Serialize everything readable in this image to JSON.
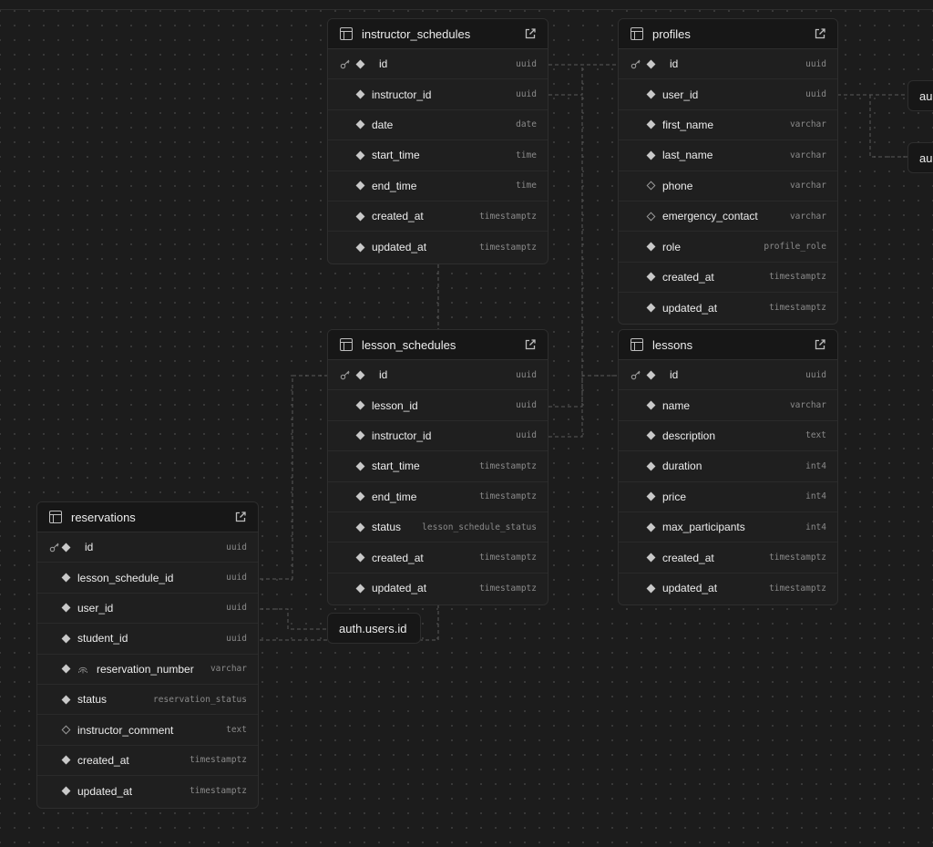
{
  "tables": {
    "instructor_schedules": {
      "name": "instructor_schedules",
      "columns": [
        {
          "name": "id",
          "type": "uuid"
        },
        {
          "name": "instructor_id",
          "type": "uuid"
        },
        {
          "name": "date",
          "type": "date"
        },
        {
          "name": "start_time",
          "type": "time"
        },
        {
          "name": "end_time",
          "type": "time"
        },
        {
          "name": "created_at",
          "type": "timestamptz"
        },
        {
          "name": "updated_at",
          "type": "timestamptz"
        }
      ]
    },
    "profiles": {
      "name": "profiles",
      "columns": [
        {
          "name": "id",
          "type": "uuid"
        },
        {
          "name": "user_id",
          "type": "uuid"
        },
        {
          "name": "first_name",
          "type": "varchar"
        },
        {
          "name": "last_name",
          "type": "varchar"
        },
        {
          "name": "phone",
          "type": "varchar"
        },
        {
          "name": "emergency_contact",
          "type": "varchar"
        },
        {
          "name": "role",
          "type": "profile_role"
        },
        {
          "name": "created_at",
          "type": "timestamptz"
        },
        {
          "name": "updated_at",
          "type": "timestamptz"
        }
      ]
    },
    "lesson_schedules": {
      "name": "lesson_schedules",
      "columns": [
        {
          "name": "id",
          "type": "uuid"
        },
        {
          "name": "lesson_id",
          "type": "uuid"
        },
        {
          "name": "instructor_id",
          "type": "uuid"
        },
        {
          "name": "start_time",
          "type": "timestamptz"
        },
        {
          "name": "end_time",
          "type": "timestamptz"
        },
        {
          "name": "status",
          "type": "lesson_schedule_status"
        },
        {
          "name": "created_at",
          "type": "timestamptz"
        },
        {
          "name": "updated_at",
          "type": "timestamptz"
        }
      ]
    },
    "lessons": {
      "name": "lessons",
      "columns": [
        {
          "name": "id",
          "type": "uuid"
        },
        {
          "name": "name",
          "type": "varchar"
        },
        {
          "name": "description",
          "type": "text"
        },
        {
          "name": "duration",
          "type": "int4"
        },
        {
          "name": "price",
          "type": "int4"
        },
        {
          "name": "max_participants",
          "type": "int4"
        },
        {
          "name": "created_at",
          "type": "timestamptz"
        },
        {
          "name": "updated_at",
          "type": "timestamptz"
        }
      ]
    },
    "reservations": {
      "name": "reservations",
      "columns": [
        {
          "name": "id",
          "type": "uuid"
        },
        {
          "name": "lesson_schedule_id",
          "type": "uuid"
        },
        {
          "name": "user_id",
          "type": "uuid"
        },
        {
          "name": "student_id",
          "type": "uuid"
        },
        {
          "name": "reservation_number",
          "type": "varchar"
        },
        {
          "name": "status",
          "type": "reservation_status"
        },
        {
          "name": "instructor_comment",
          "type": "text"
        },
        {
          "name": "created_at",
          "type": "timestamptz"
        },
        {
          "name": "updated_at",
          "type": "timestamptz"
        }
      ]
    }
  },
  "nodes": {
    "auth_users_id": "auth.users.id",
    "auth_partial_1": "au",
    "auth_partial_2": "au"
  }
}
